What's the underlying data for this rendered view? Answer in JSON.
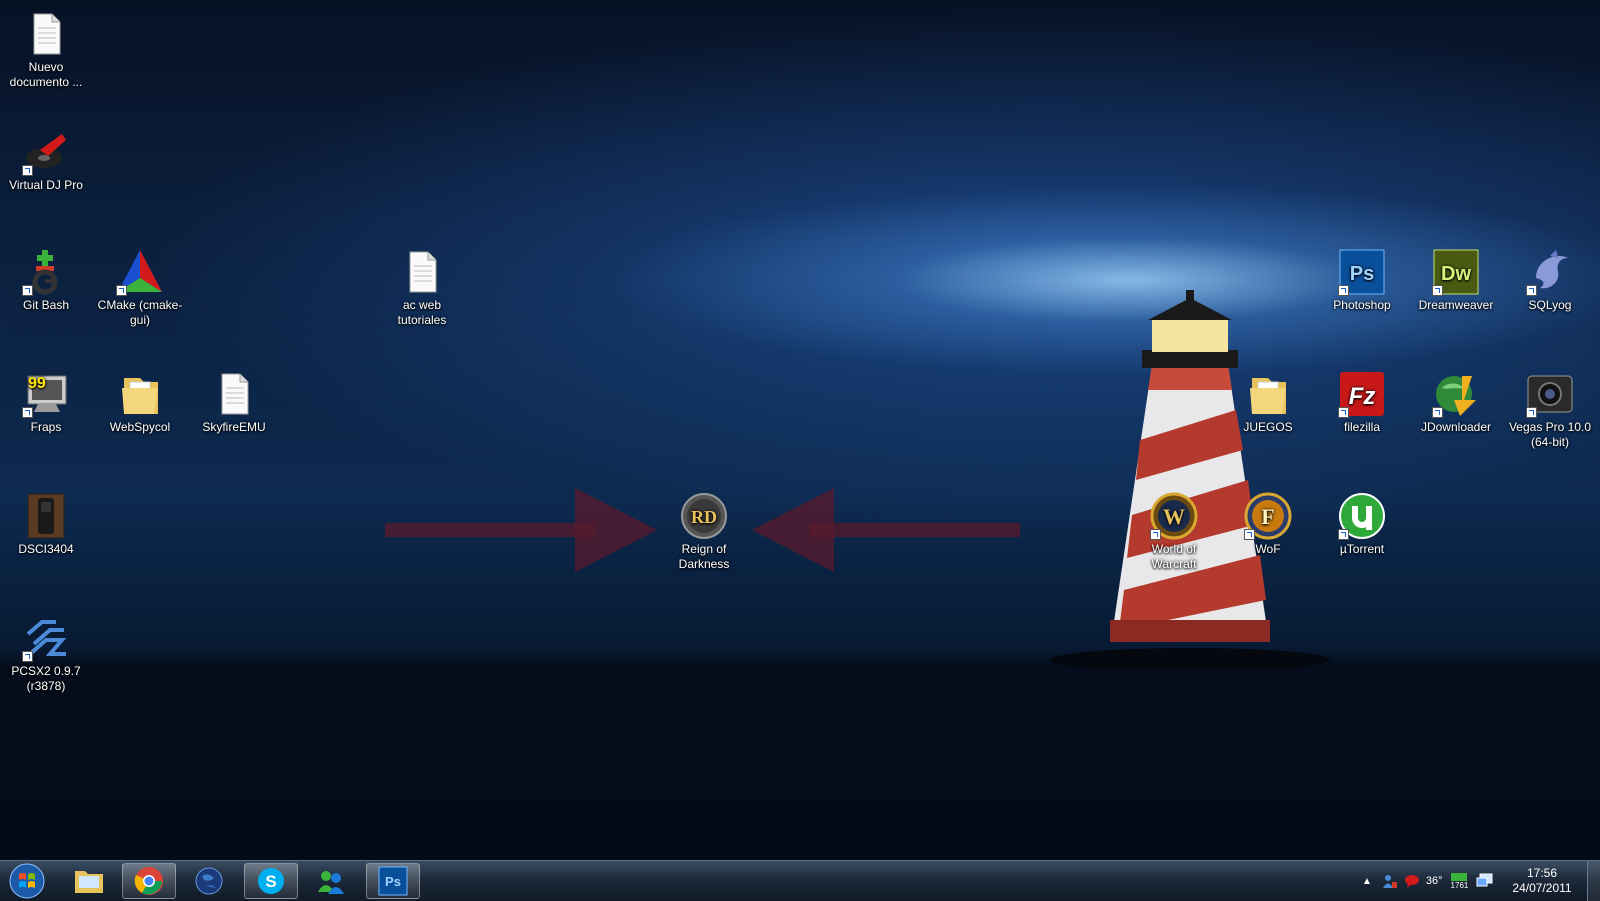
{
  "desktop": {
    "icons": [
      {
        "id": "nuevo-documento",
        "label": "Nuevo documento ...",
        "icon": "text-document-icon"
      },
      {
        "id": "virtual-dj",
        "label": "Virtual DJ Pro",
        "icon": "virtual-dj-icon"
      },
      {
        "id": "git-bash",
        "label": "Git Bash",
        "icon": "git-bash-icon"
      },
      {
        "id": "cmake",
        "label": "CMake (cmake-gui)",
        "icon": "cmake-icon"
      },
      {
        "id": "ac-web",
        "label": "ac web tutoriales",
        "icon": "text-document-icon"
      },
      {
        "id": "photoshop",
        "label": "Photoshop",
        "icon": "photoshop-icon"
      },
      {
        "id": "dreamweaver",
        "label": "Dreamweaver",
        "icon": "dreamweaver-icon"
      },
      {
        "id": "sqlyog",
        "label": "SQLyog",
        "icon": "dolphin-icon"
      },
      {
        "id": "fraps",
        "label": "Fraps",
        "icon": "fraps-icon"
      },
      {
        "id": "webspycol",
        "label": "WebSpycol",
        "icon": "folder-icon"
      },
      {
        "id": "skyfireemu",
        "label": "SkyfireEMU",
        "icon": "text-document-icon"
      },
      {
        "id": "juegos",
        "label": "JUEGOS",
        "icon": "folder-icon"
      },
      {
        "id": "filezilla",
        "label": "filezilla",
        "icon": "filezilla-icon"
      },
      {
        "id": "jdownloader",
        "label": "JDownloader",
        "icon": "jdownloader-icon"
      },
      {
        "id": "vegas",
        "label": "Vegas Pro 10.0 (64-bit)",
        "icon": "vegas-icon"
      },
      {
        "id": "dsci3404",
        "label": "DSCI3404",
        "icon": "phone-photo-icon"
      },
      {
        "id": "reign",
        "label": "Reign of Darkness",
        "icon": "reign-of-darkness-icon"
      },
      {
        "id": "wow",
        "label": "World of Warcraft",
        "icon": "wow-icon"
      },
      {
        "id": "wof",
        "label": "WoF",
        "icon": "wof-icon"
      },
      {
        "id": "utorrent",
        "label": "µTorrent",
        "icon": "utorrent-icon"
      },
      {
        "id": "pcsx2",
        "label": "PCSX2 0.9.7 (r3878)",
        "icon": "pcsx2-icon"
      }
    ]
  },
  "taskbar": {
    "buttons": [
      {
        "id": "start",
        "icon": "windows-start-icon"
      },
      {
        "id": "explorer",
        "icon": "folder-icon"
      },
      {
        "id": "chrome",
        "icon": "chrome-icon"
      },
      {
        "id": "globe",
        "icon": "globe-icon"
      },
      {
        "id": "skype",
        "icon": "skype-icon"
      },
      {
        "id": "messenger",
        "icon": "messenger-icon"
      },
      {
        "id": "photoshop",
        "icon": "photoshop-icon"
      }
    ],
    "tray": {
      "temperature": "36°",
      "network_label": "1761"
    },
    "clock": {
      "time": "17:56",
      "date": "24/07/2011"
    }
  },
  "colors": {
    "accent": "#1e6fd9",
    "arrow": "#5a1a2c"
  }
}
